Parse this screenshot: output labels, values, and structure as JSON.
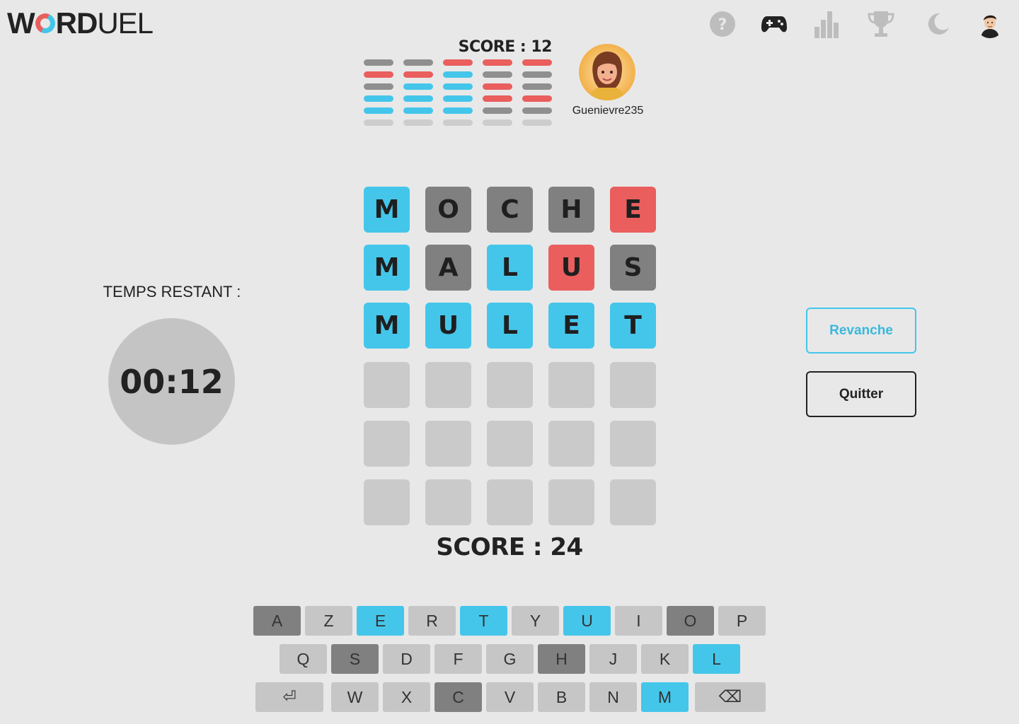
{
  "logo": {
    "part1": "W",
    "part2": "RD",
    "part3": "UEL"
  },
  "nav_icons": [
    "help-icon",
    "gamepad-icon",
    "stats-icon",
    "trophy-icon",
    "dark-mode-icon",
    "user-avatar"
  ],
  "opponent": {
    "score_text": "SCORE : 12",
    "name": "Guenievre235",
    "history": [
      [
        "gray",
        "red",
        "gray",
        "blue",
        "blue",
        "empty"
      ],
      [
        "gray",
        "red",
        "blue",
        "blue",
        "blue",
        "empty"
      ],
      [
        "red",
        "blue",
        "blue",
        "blue",
        "blue",
        "empty"
      ],
      [
        "red",
        "gray",
        "red",
        "red",
        "gray",
        "empty"
      ],
      [
        "red",
        "gray",
        "gray",
        "red",
        "gray",
        "empty"
      ]
    ]
  },
  "timer": {
    "label": "TEMPS RESTANT :",
    "value": "00:12"
  },
  "board": {
    "rows": [
      [
        {
          "l": "M",
          "s": "blue"
        },
        {
          "l": "O",
          "s": "gray"
        },
        {
          "l": "C",
          "s": "gray"
        },
        {
          "l": "H",
          "s": "gray"
        },
        {
          "l": "E",
          "s": "red"
        }
      ],
      [
        {
          "l": "M",
          "s": "blue"
        },
        {
          "l": "A",
          "s": "gray"
        },
        {
          "l": "L",
          "s": "blue"
        },
        {
          "l": "U",
          "s": "red"
        },
        {
          "l": "S",
          "s": "gray"
        }
      ],
      [
        {
          "l": "M",
          "s": "blue"
        },
        {
          "l": "U",
          "s": "blue"
        },
        {
          "l": "L",
          "s": "blue"
        },
        {
          "l": "E",
          "s": "blue"
        },
        {
          "l": "T",
          "s": "blue"
        }
      ],
      [
        {
          "l": "",
          "s": "empty"
        },
        {
          "l": "",
          "s": "empty"
        },
        {
          "l": "",
          "s": "empty"
        },
        {
          "l": "",
          "s": "empty"
        },
        {
          "l": "",
          "s": "empty"
        }
      ],
      [
        {
          "l": "",
          "s": "empty"
        },
        {
          "l": "",
          "s": "empty"
        },
        {
          "l": "",
          "s": "empty"
        },
        {
          "l": "",
          "s": "empty"
        },
        {
          "l": "",
          "s": "empty"
        }
      ],
      [
        {
          "l": "",
          "s": "empty"
        },
        {
          "l": "",
          "s": "empty"
        },
        {
          "l": "",
          "s": "empty"
        },
        {
          "l": "",
          "s": "empty"
        },
        {
          "l": "",
          "s": "empty"
        }
      ]
    ]
  },
  "my_score_text": "SCORE : 24",
  "buttons": {
    "revanche": "Revanche",
    "quitter": "Quitter"
  },
  "keyboard": {
    "rows": [
      [
        {
          "k": "A",
          "s": "gray"
        },
        {
          "k": "Z",
          "s": "light"
        },
        {
          "k": "E",
          "s": "blue"
        },
        {
          "k": "R",
          "s": "light"
        },
        {
          "k": "T",
          "s": "blue"
        },
        {
          "k": "Y",
          "s": "light"
        },
        {
          "k": "U",
          "s": "blue"
        },
        {
          "k": "I",
          "s": "light"
        },
        {
          "k": "O",
          "s": "gray"
        },
        {
          "k": "P",
          "s": "light"
        }
      ],
      [
        {
          "k": "Q",
          "s": "light"
        },
        {
          "k": "S",
          "s": "gray"
        },
        {
          "k": "D",
          "s": "light"
        },
        {
          "k": "F",
          "s": "light"
        },
        {
          "k": "G",
          "s": "light"
        },
        {
          "k": "H",
          "s": "gray"
        },
        {
          "k": "J",
          "s": "light"
        },
        {
          "k": "K",
          "s": "light"
        },
        {
          "k": "L",
          "s": "blue"
        }
      ],
      [
        {
          "k": "⏎",
          "s": "light",
          "name": "enter"
        },
        {
          "k": "W",
          "s": "light"
        },
        {
          "k": "X",
          "s": "light"
        },
        {
          "k": "C",
          "s": "gray"
        },
        {
          "k": "V",
          "s": "light"
        },
        {
          "k": "B",
          "s": "light"
        },
        {
          "k": "N",
          "s": "light"
        },
        {
          "k": "M",
          "s": "blue"
        },
        {
          "k": "⌫",
          "s": "light",
          "name": "backspace"
        }
      ]
    ]
  },
  "colors": {
    "blue": "#44c6ea",
    "red": "#ea5e5e",
    "gray": "#808080",
    "empty": "#cacaca",
    "key_light": "#c6c6c6",
    "key_gray": "#808080",
    "mini_gray": "#8f8f8f",
    "mini_empty": "#cdcdcd"
  }
}
